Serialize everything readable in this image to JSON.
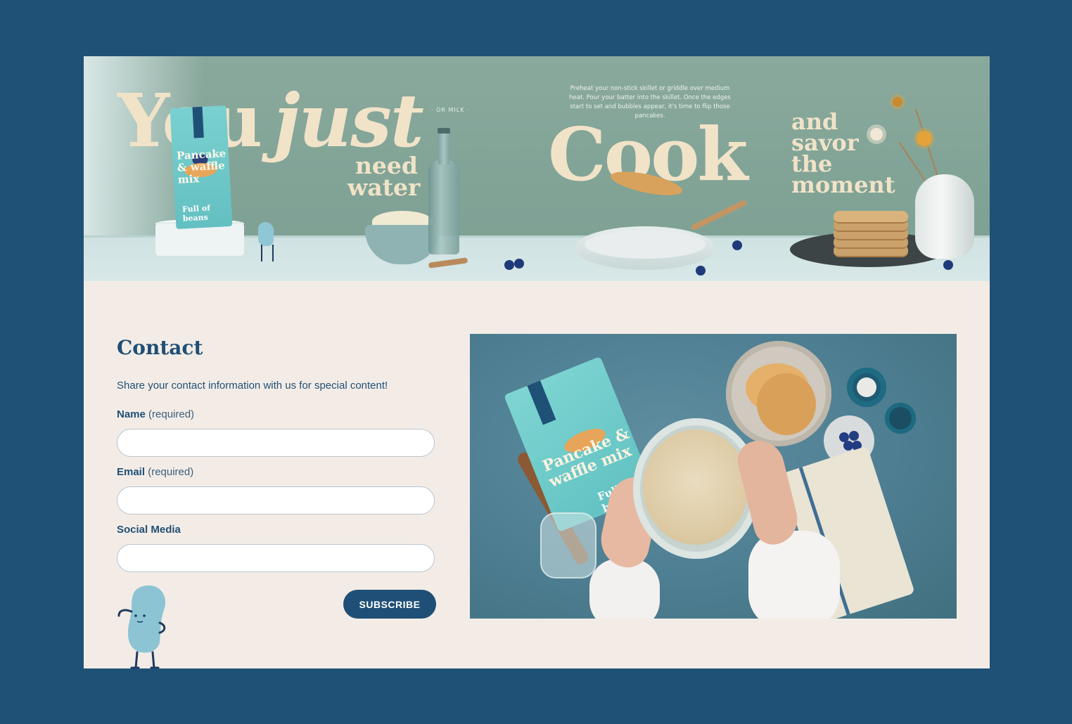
{
  "hero": {
    "headline_you": "You",
    "headline_just": "just",
    "need_water": "need water",
    "or_milk": "· OR MILK ·",
    "preheat_text": "Preheat your non-stick skillet or griddle over medium heat. Pour your batter into the skillet. Once the edges start to set and bubbles appear, it's time to flip those pancakes.",
    "cook": "Cook",
    "savor": "and savor the moment",
    "bag_text": "Pancake & waffle mix",
    "bag_brand": "Full of beans"
  },
  "contact": {
    "title": "Contact",
    "intro": "Share your contact information with us for special content!",
    "fields": [
      {
        "label": "Name",
        "required_text": "(required)",
        "value": ""
      },
      {
        "label": "Email",
        "required_text": "(required)",
        "value": ""
      },
      {
        "label": "Social Media",
        "required_text": "",
        "value": ""
      }
    ],
    "subscribe_label": "SUBSCRIBE"
  },
  "photo": {
    "bag_text": "Pancake & waffle mix",
    "bag_brand": "Full of beans"
  },
  "colors": {
    "frame_bg": "#1f5177",
    "page_bg": "#f3ece6",
    "hero_bg": "#84a69a",
    "accent_navy": "#1f4f76",
    "cream_text": "#f1e3c8"
  },
  "icons": [
    "bean-mascot-icon"
  ]
}
